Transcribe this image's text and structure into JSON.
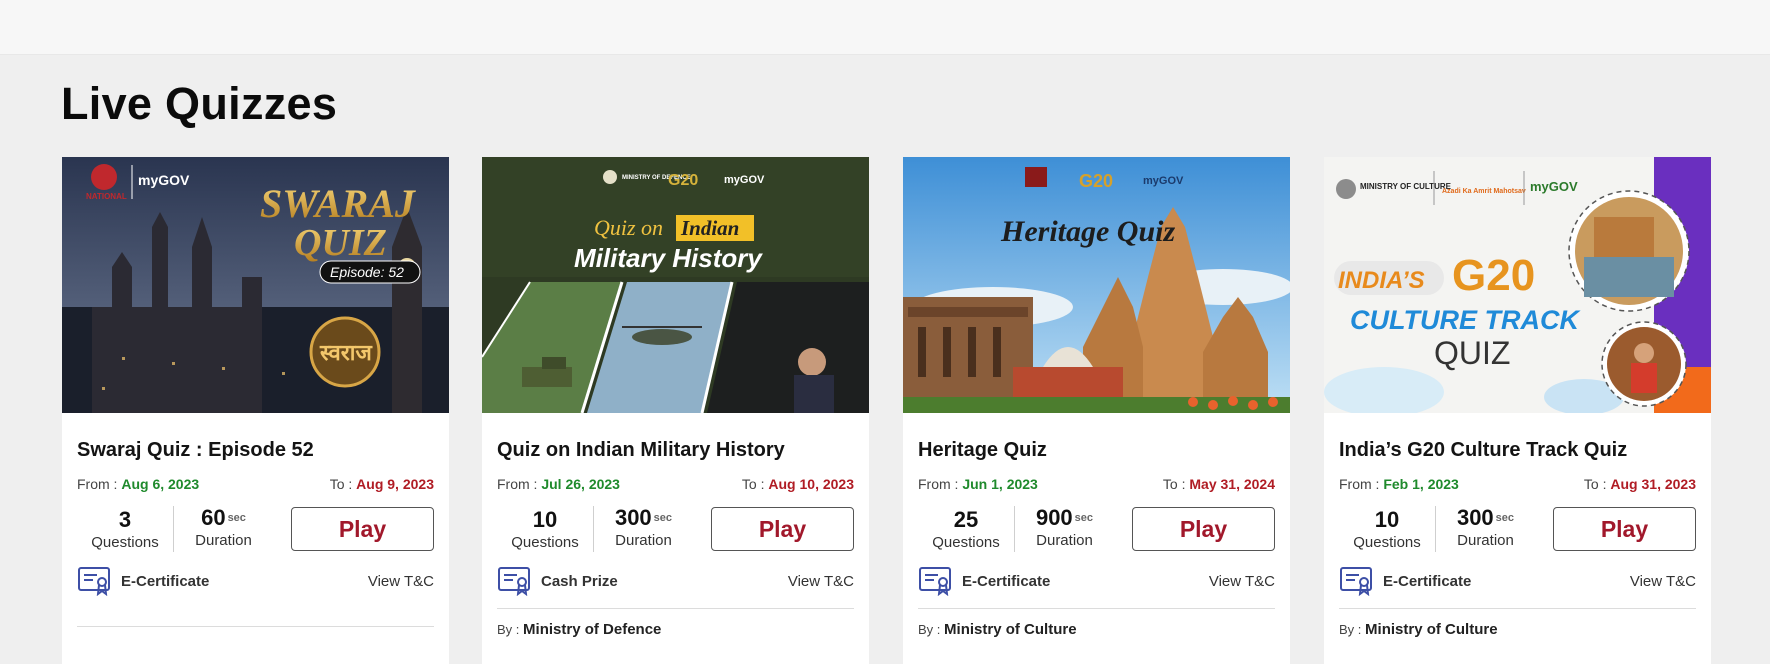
{
  "page": {
    "section_title": "Live Quizzes"
  },
  "labels": {
    "from": "From :",
    "to": "To :",
    "questions": "Questions",
    "duration": "Duration",
    "sec": "sec",
    "play": "Play",
    "view_tnc": "View T&C",
    "by": "By :"
  },
  "quizzes": [
    {
      "title": "Swaraj Quiz : Episode 52",
      "from": "Aug 6, 2023",
      "to": "Aug 9, 2023",
      "questions": "3",
      "duration": "60",
      "reward": "E-Certificate",
      "by": "",
      "banner": {
        "heading1": "SWARAJ",
        "heading2": "QUIZ",
        "badge": "Episode: 52",
        "emblem": "स्वराज",
        "logo1": "NATIONAL",
        "logo2": "myGOV"
      }
    },
    {
      "title": "Quiz on Indian Military History",
      "from": "Jul 26, 2023",
      "to": "Aug 10, 2023",
      "questions": "10",
      "duration": "300",
      "reward": "Cash Prize",
      "by": "Ministry of Defence",
      "banner": {
        "heading1": "Quiz on",
        "heading1b": "Indian",
        "heading2": "Military History",
        "logo1": "MINISTRY OF DEFENCE",
        "logo2": "G20",
        "logo3": "myGOV"
      }
    },
    {
      "title": "Heritage Quiz",
      "from": "Jun 1, 2023",
      "to": "May 31, 2024",
      "questions": "25",
      "duration": "900",
      "reward": "E-Certificate",
      "by": "Ministry of Culture",
      "banner": {
        "heading1": "Heritage Quiz",
        "logo2": "G20",
        "logo3": "myGOV"
      }
    },
    {
      "title": "India’s G20 Culture Track Quiz",
      "from": "Feb 1, 2023",
      "to": "Aug 31, 2023",
      "questions": "10",
      "duration": "300",
      "reward": "E-Certificate",
      "by": "Ministry of Culture",
      "banner": {
        "heading1": "INDIA’S",
        "heading1b": "G20",
        "heading2": "CULTURE TRACK",
        "heading3": "QUIZ",
        "logo1": "MINISTRY OF CULTURE",
        "logo2": "Azadi Ka Amrit Mahotsav",
        "logo3": "myGOV"
      }
    }
  ],
  "colors": {
    "from": "#1f8a2c",
    "to": "#b01c24",
    "play": "#a1182b",
    "cert_icon": "#3d4fa6"
  }
}
